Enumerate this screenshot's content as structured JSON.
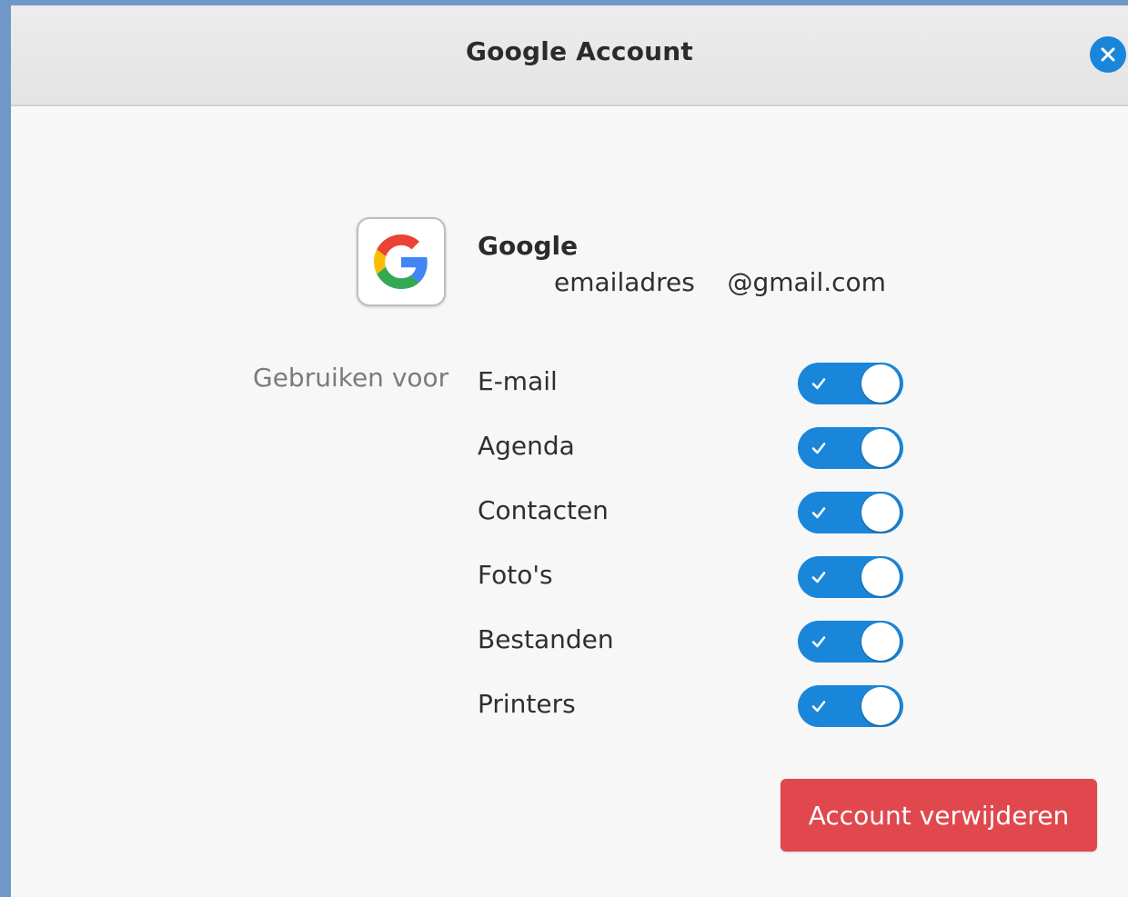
{
  "window": {
    "title": "Google Account"
  },
  "account": {
    "provider": "Google",
    "email": "emailadres    @gmail.com"
  },
  "usage": {
    "label": "Gebruiken voor",
    "services": [
      {
        "name": "E-mail",
        "enabled": true
      },
      {
        "name": "Agenda",
        "enabled": true
      },
      {
        "name": "Contacten",
        "enabled": true
      },
      {
        "name": "Foto's",
        "enabled": true
      },
      {
        "name": "Bestanden",
        "enabled": true
      },
      {
        "name": "Printers",
        "enabled": true
      }
    ]
  },
  "actions": {
    "remove_label": "Account verwijderen"
  },
  "icons": {
    "close": "close-icon",
    "provider": "google-logo-icon",
    "toggle_on": "check-icon"
  },
  "colors": {
    "accent": "#1a86d9",
    "destructive": "#e0484e"
  }
}
